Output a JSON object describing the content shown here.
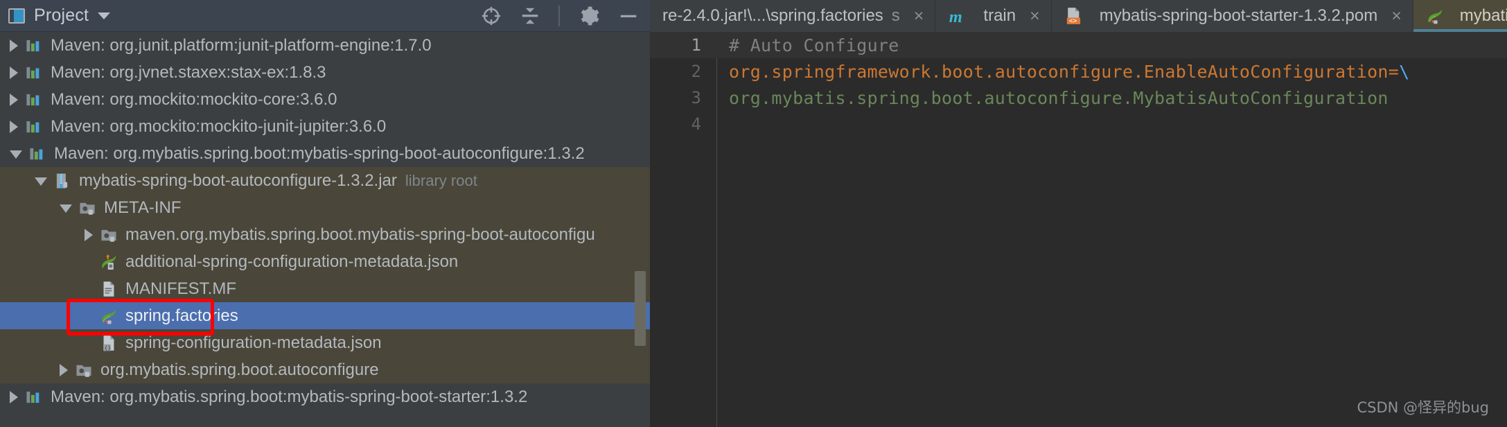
{
  "project_panel": {
    "title": "Project",
    "window_icon": "project-window-icon",
    "dropdown_icon": "chevron-down-icon",
    "toolbar": [
      {
        "name": "locate-in-tree-icon",
        "title": "Select Opened File"
      },
      {
        "name": "collapse-all-icon",
        "title": "Collapse All"
      },
      {
        "name": "gear-icon",
        "title": "Settings"
      },
      {
        "name": "minimize-icon",
        "title": "Hide"
      }
    ],
    "tree": [
      {
        "label": "Maven: org.junit.platform:junit-platform-engine:1.7.0",
        "indent": 0,
        "arrow": "closed",
        "icon": "maven-library-icon",
        "state": "normal",
        "suffix": ""
      },
      {
        "label": "Maven: org.jvnet.staxex:stax-ex:1.8.3",
        "indent": 0,
        "arrow": "closed",
        "icon": "maven-library-icon",
        "state": "normal",
        "suffix": ""
      },
      {
        "label": "Maven: org.mockito:mockito-core:3.6.0",
        "indent": 0,
        "arrow": "closed",
        "icon": "maven-library-icon",
        "state": "normal",
        "suffix": ""
      },
      {
        "label": "Maven: org.mockito:mockito-junit-jupiter:3.6.0",
        "indent": 0,
        "arrow": "closed",
        "icon": "maven-library-icon",
        "state": "normal",
        "suffix": ""
      },
      {
        "label": "Maven: org.mybatis.spring.boot:mybatis-spring-boot-autoconfigure:1.3.2",
        "indent": 0,
        "arrow": "open",
        "icon": "maven-library-icon",
        "state": "normal",
        "suffix": ""
      },
      {
        "label": "mybatis-spring-boot-autoconfigure-1.3.2.jar",
        "indent": 1,
        "arrow": "open",
        "icon": "jar-icon",
        "state": "library",
        "suffix": "library root"
      },
      {
        "label": "META-INF",
        "indent": 2,
        "arrow": "open",
        "icon": "folder-icon",
        "state": "library",
        "suffix": ""
      },
      {
        "label": "maven.org.mybatis.spring.boot.mybatis-spring-boot-autoconfigu",
        "indent": 3,
        "arrow": "closed",
        "icon": "folder-icon",
        "state": "library",
        "suffix": ""
      },
      {
        "label": "additional-spring-configuration-metadata.json",
        "indent": 3,
        "arrow": "none",
        "icon": "spring-json-icon",
        "state": "library",
        "suffix": ""
      },
      {
        "label": "MANIFEST.MF",
        "indent": 3,
        "arrow": "none",
        "icon": "manifest-icon",
        "state": "library",
        "suffix": ""
      },
      {
        "label": "spring.factories",
        "indent": 3,
        "arrow": "none",
        "icon": "spring-leaf-icon",
        "state": "selected",
        "suffix": ""
      },
      {
        "label": "spring-configuration-metadata.json",
        "indent": 3,
        "arrow": "none",
        "icon": "json-config-icon",
        "state": "library",
        "suffix": ""
      },
      {
        "label": "org.mybatis.spring.boot.autoconfigure",
        "indent": 2,
        "arrow": "closed",
        "icon": "package-icon",
        "state": "library",
        "suffix": ""
      },
      {
        "label": "Maven: org.mybatis.spring.boot:mybatis-spring-boot-starter:1.3.2",
        "indent": 0,
        "arrow": "closed",
        "icon": "maven-library-icon",
        "state": "normal",
        "suffix": ""
      }
    ],
    "scrollbar": "tree-vertical-scrollbar"
  },
  "editor": {
    "tabs": [
      {
        "label": "re-2.4.0.jar!\\...\\spring.factories",
        "truncated_tail": "s",
        "icon": "",
        "active": false,
        "closable": true
      },
      {
        "label": "train",
        "icon": "mybatis-m-icon",
        "active": false,
        "closable": true
      },
      {
        "label": "mybatis-spring-boot-starter-1.3.2.pom",
        "icon": "xml-file-icon",
        "active": false,
        "closable": true
      },
      {
        "label": "mybatis-s",
        "icon": "spring-leaf-icon",
        "active": true,
        "closable": false
      }
    ],
    "lines": [
      {
        "number": "1",
        "current": true,
        "segments": [
          {
            "text": "# Auto Configure",
            "cls": "c-comment"
          }
        ]
      },
      {
        "number": "2",
        "current": false,
        "segments": [
          {
            "text": "org.springframework.boot.autoconfigure.EnableAutoConfiguration=",
            "cls": "c-key"
          },
          {
            "text": "\\",
            "cls": "c-esc"
          }
        ]
      },
      {
        "number": "3",
        "current": false,
        "segments": [
          {
            "text": "org.mybatis.spring.boot.autoconfigure.MybatisAutoConfiguration",
            "cls": "c-val"
          }
        ]
      },
      {
        "number": "4",
        "current": false,
        "segments": [
          {
            "text": "",
            "cls": "c-val"
          }
        ]
      }
    ]
  },
  "watermark": "CSDN @怪异的bug",
  "annotation": {
    "name": "red-highlight-box",
    "color": "#ff0000"
  },
  "colors": {
    "panel_bg": "#3c3f41",
    "header_bg": "#3c4450",
    "editor_bg": "#2b2b2b",
    "library_bg": "#4a4639",
    "selection_bg": "#4b6eaf",
    "active_tab_bg": "#4e4b3b",
    "active_tab_underline": "#4e8098",
    "accent_blue": "#3592c4",
    "comment": "#808080",
    "key_orange": "#cc7832",
    "value_green": "#6a8759",
    "escape_cyan": "#56a8f5"
  }
}
